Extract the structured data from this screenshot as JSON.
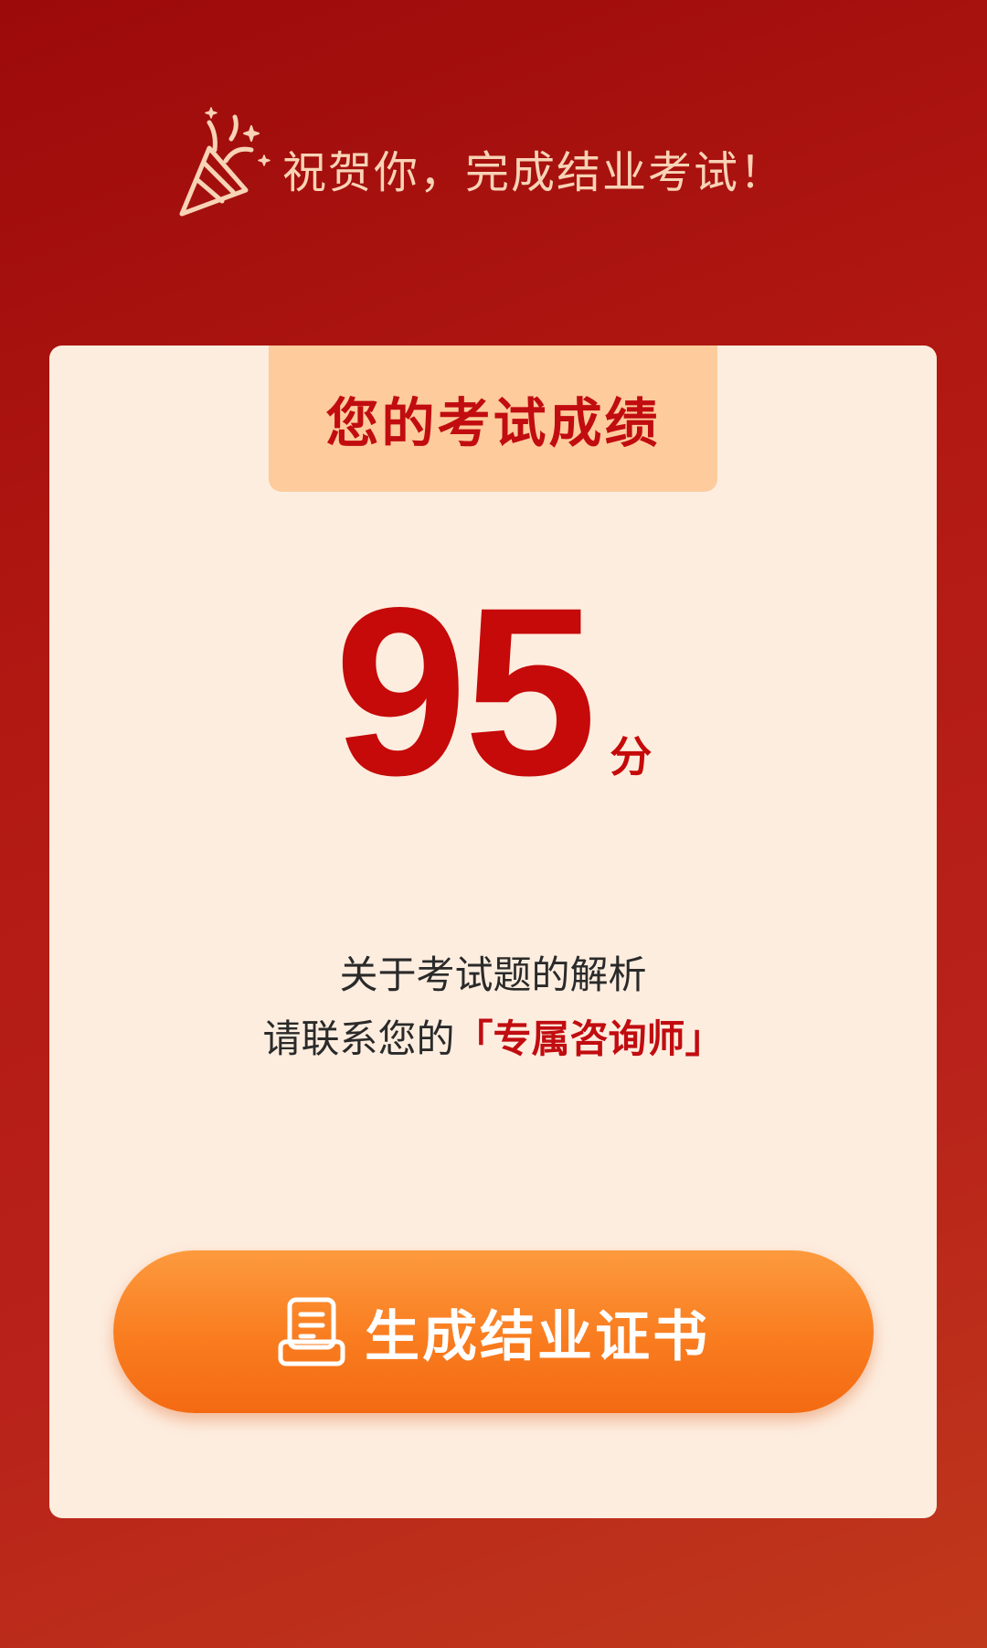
{
  "header": {
    "icon": "party-popper-icon",
    "text": "祝贺你，完成结业考试！"
  },
  "card": {
    "title": "您的考试成绩",
    "score": "95",
    "score_unit": "分",
    "note_line1": "关于考试题的解析",
    "note_line2_prefix": "请联系您的",
    "note_line2_highlight": "「专属咨询师」"
  },
  "button": {
    "icon": "document-icon",
    "label": "生成结业证书"
  },
  "colors": {
    "background": "#b11812",
    "card": "#fdeddf",
    "tab": "#fdcb9c",
    "accent_red": "#c60909",
    "button_orange": "#f97c1f",
    "header_text": "#f8d3b6"
  }
}
